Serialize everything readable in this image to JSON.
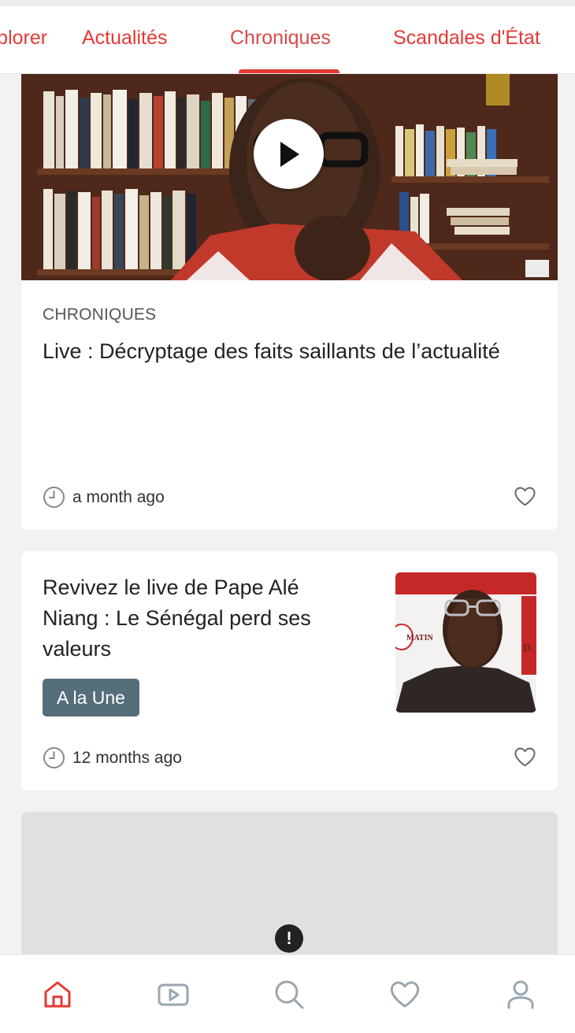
{
  "tabs": [
    {
      "label": "Explorer",
      "active": false
    },
    {
      "label": "Actualités",
      "active": false
    },
    {
      "label": "Chroniques",
      "active": true
    },
    {
      "label": "Scandales d'État",
      "active": false
    }
  ],
  "colors": {
    "accent": "#e53935",
    "badge": "#546e7a",
    "nav_icon": "#9aa7b0",
    "nav_active": "#e53935"
  },
  "featured": {
    "category": "CHRONIQUES",
    "title": "Live : Décryptage des faits saillants de l’actualité",
    "time": "a month ago",
    "icons": {
      "play": "play-icon",
      "clock": "clock-icon",
      "like": "heart-icon"
    }
  },
  "article2": {
    "title": "Revivez le live de Pape Alé Niang : Le Sénégal perd ses valeurs",
    "badge": "A la Une",
    "time": "12 months ago",
    "thumb_text_left": "MATIN",
    "thumb_text_right": "D."
  },
  "placeholder": {
    "icon": "error-icon",
    "glyph": "!"
  },
  "bottom_nav": [
    {
      "name": "home",
      "icon": "home-icon",
      "active": true
    },
    {
      "name": "videos",
      "icon": "video-icon",
      "active": false
    },
    {
      "name": "search",
      "icon": "search-icon",
      "active": false
    },
    {
      "name": "favorites",
      "icon": "heart-icon",
      "active": false
    },
    {
      "name": "profile",
      "icon": "user-icon",
      "active": false
    }
  ]
}
